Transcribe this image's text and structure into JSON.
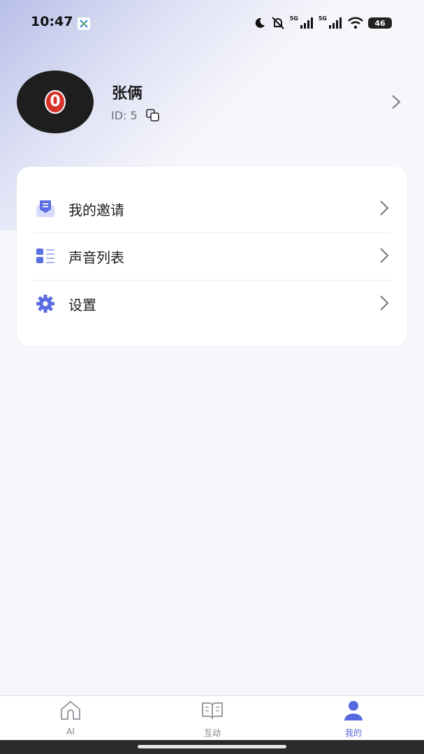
{
  "status_bar": {
    "time": "10:47",
    "network_1": "5G",
    "network_2": "5G",
    "battery": "46"
  },
  "profile": {
    "avatar_text": "0",
    "name": "张俩",
    "id_text": "ID: 5"
  },
  "menu": {
    "items": [
      {
        "label": "我的邀请",
        "icon": "mail-envelope-icon"
      },
      {
        "label": "声音列表",
        "icon": "list-icon"
      },
      {
        "label": "设置",
        "icon": "gear-icon"
      }
    ]
  },
  "bottom_nav": {
    "items": [
      {
        "label": "AI",
        "icon": "home-icon",
        "active": false
      },
      {
        "label": "互动",
        "icon": "book-icon",
        "active": false
      },
      {
        "label": "我的",
        "icon": "person-icon",
        "active": true
      }
    ]
  },
  "colors": {
    "accent": "#5468e0",
    "icon_blue": "#5b6ee1",
    "avatar_badge": "#d6332a"
  }
}
